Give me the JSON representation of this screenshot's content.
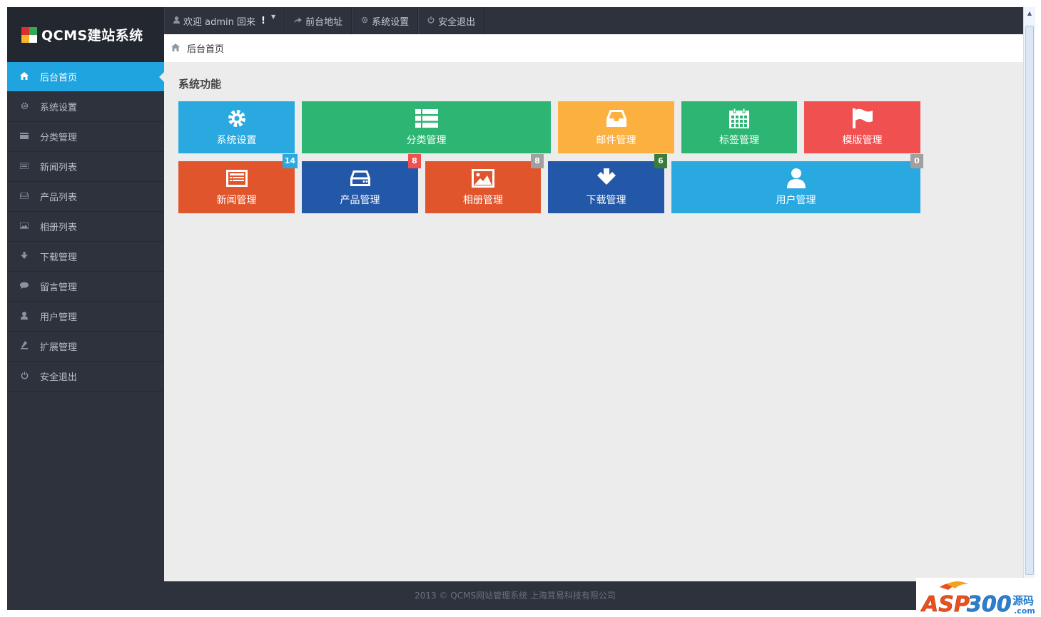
{
  "app": {
    "logo_text": "QCMS建站系统",
    "logo_colors": [
      "#d9322b",
      "#34a853",
      "#f7b52c",
      "#1fa4e0"
    ]
  },
  "topbar": {
    "welcome_label": "欢迎 admin 回来",
    "frontend_label": "前台地址",
    "settings_label": "系统设置",
    "logout_label": "安全退出"
  },
  "breadcrumb": {
    "current": "后台首页"
  },
  "sidebar": {
    "items": [
      {
        "label": "后台首页",
        "icon": "home-icon"
      },
      {
        "label": "系统设置",
        "icon": "gear-icon"
      },
      {
        "label": "分类管理",
        "icon": "folder-icon"
      },
      {
        "label": "新闻列表",
        "icon": "list-icon"
      },
      {
        "label": "产品列表",
        "icon": "drive-icon"
      },
      {
        "label": "相册列表",
        "icon": "picture-icon"
      },
      {
        "label": "下载管理",
        "icon": "arrow-down-icon"
      },
      {
        "label": "留言管理",
        "icon": "comment-icon"
      },
      {
        "label": "用户管理",
        "icon": "user-icon"
      },
      {
        "label": "扩展管理",
        "icon": "tool-icon"
      },
      {
        "label": "安全退出",
        "icon": "power-icon"
      }
    ]
  },
  "main": {
    "section_title": "系统功能",
    "tiles": [
      {
        "label": "系统设置",
        "icon": "gear-icon",
        "color": "#2aa9e0"
      },
      {
        "label": "分类管理",
        "icon": "list-icon",
        "color": "#2db573"
      },
      {
        "label": "邮件管理",
        "icon": "inbox-icon",
        "color": "#fbb040"
      },
      {
        "label": "标签管理",
        "icon": "calendar-icon",
        "color": "#2db573"
      },
      {
        "label": "模版管理",
        "icon": "flag-icon",
        "color": "#f05050"
      },
      {
        "label": "新闻管理",
        "icon": "news-icon",
        "color": "#e0552c",
        "badge": "14",
        "badge_color": "#2aa9e0"
      },
      {
        "label": "产品管理",
        "icon": "drive-icon",
        "color": "#2358a8",
        "badge": "8",
        "badge_color": "#f05050"
      },
      {
        "label": "相册管理",
        "icon": "picture-icon",
        "color": "#e0552c",
        "badge": "8",
        "badge_color": "#a0a0a0"
      },
      {
        "label": "下载管理",
        "icon": "arrow-down-icon",
        "color": "#2358a8",
        "badge": "6",
        "badge_color": "#3a7d3a"
      },
      {
        "label": "用户管理",
        "icon": "user-icon",
        "color": "#2aa9e0",
        "badge": "0",
        "badge_color": "#a0a0a0"
      }
    ]
  },
  "footer": {
    "text": "2013 © QCMS网站管理系统 上海茸易科技有限公司"
  },
  "watermark": {
    "text": "ASP300源码 .com"
  }
}
